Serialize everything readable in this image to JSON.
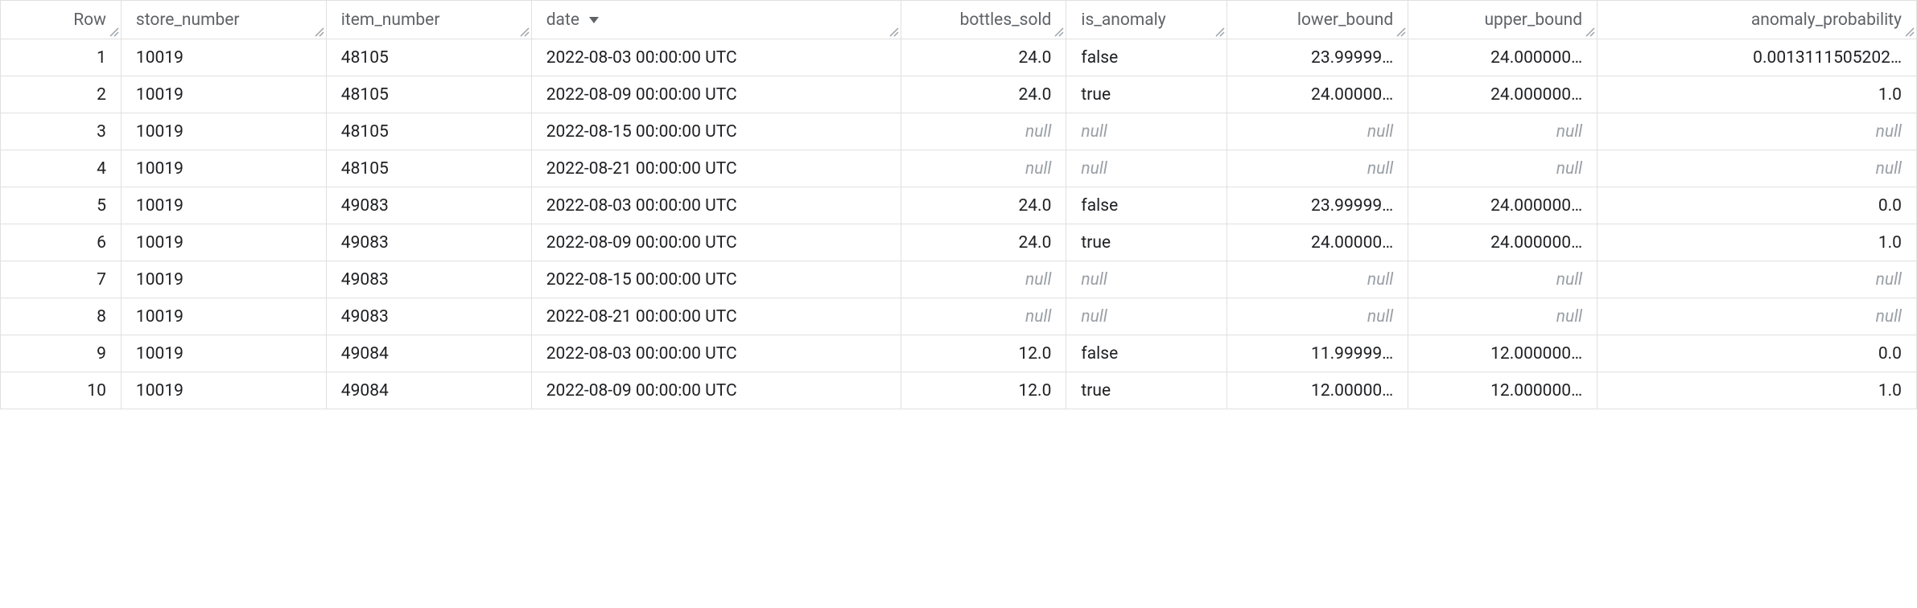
{
  "columns": [
    {
      "key": "row",
      "label": "Row",
      "align": "num",
      "cls": "c-row",
      "sorted": false
    },
    {
      "key": "store",
      "label": "store_number",
      "align": "txt",
      "cls": "c-store",
      "sorted": false
    },
    {
      "key": "item",
      "label": "item_number",
      "align": "txt",
      "cls": "c-item",
      "sorted": false
    },
    {
      "key": "date",
      "label": "date",
      "align": "txt",
      "cls": "c-date",
      "sorted": true
    },
    {
      "key": "bottles",
      "label": "bottles_sold",
      "align": "num",
      "cls": "c-bottles",
      "sorted": false
    },
    {
      "key": "is_anom",
      "label": "is_anomaly",
      "align": "txt",
      "cls": "c-anom",
      "sorted": false
    },
    {
      "key": "lb",
      "label": "lower_bound",
      "align": "num",
      "cls": "c-lb",
      "sorted": false
    },
    {
      "key": "ub",
      "label": "upper_bound",
      "align": "num",
      "cls": "c-ub",
      "sorted": false
    },
    {
      "key": "prob",
      "label": "anomaly_probability",
      "align": "num",
      "cls": "c-prob",
      "sorted": false
    }
  ],
  "null_text": "null",
  "rows": [
    {
      "row": "1",
      "store": "10019",
      "item": "48105",
      "date": "2022-08-03 00:00:00 UTC",
      "bottles": "24.0",
      "is_anom": "false",
      "lb": "23.99999…",
      "ub": "24.000000…",
      "prob": "0.0013111505202…"
    },
    {
      "row": "2",
      "store": "10019",
      "item": "48105",
      "date": "2022-08-09 00:00:00 UTC",
      "bottles": "24.0",
      "is_anom": "true",
      "lb": "24.00000…",
      "ub": "24.000000…",
      "prob": "1.0"
    },
    {
      "row": "3",
      "store": "10019",
      "item": "48105",
      "date": "2022-08-15 00:00:00 UTC",
      "bottles": null,
      "is_anom": null,
      "lb": null,
      "ub": null,
      "prob": null
    },
    {
      "row": "4",
      "store": "10019",
      "item": "48105",
      "date": "2022-08-21 00:00:00 UTC",
      "bottles": null,
      "is_anom": null,
      "lb": null,
      "ub": null,
      "prob": null
    },
    {
      "row": "5",
      "store": "10019",
      "item": "49083",
      "date": "2022-08-03 00:00:00 UTC",
      "bottles": "24.0",
      "is_anom": "false",
      "lb": "23.99999…",
      "ub": "24.000000…",
      "prob": "0.0"
    },
    {
      "row": "6",
      "store": "10019",
      "item": "49083",
      "date": "2022-08-09 00:00:00 UTC",
      "bottles": "24.0",
      "is_anom": "true",
      "lb": "24.00000…",
      "ub": "24.000000…",
      "prob": "1.0"
    },
    {
      "row": "7",
      "store": "10019",
      "item": "49083",
      "date": "2022-08-15 00:00:00 UTC",
      "bottles": null,
      "is_anom": null,
      "lb": null,
      "ub": null,
      "prob": null
    },
    {
      "row": "8",
      "store": "10019",
      "item": "49083",
      "date": "2022-08-21 00:00:00 UTC",
      "bottles": null,
      "is_anom": null,
      "lb": null,
      "ub": null,
      "prob": null
    },
    {
      "row": "9",
      "store": "10019",
      "item": "49084",
      "date": "2022-08-03 00:00:00 UTC",
      "bottles": "12.0",
      "is_anom": "false",
      "lb": "11.99999…",
      "ub": "12.000000…",
      "prob": "0.0"
    },
    {
      "row": "10",
      "store": "10019",
      "item": "49084",
      "date": "2022-08-09 00:00:00 UTC",
      "bottles": "12.0",
      "is_anom": "true",
      "lb": "12.00000…",
      "ub": "12.000000…",
      "prob": "1.0"
    }
  ]
}
